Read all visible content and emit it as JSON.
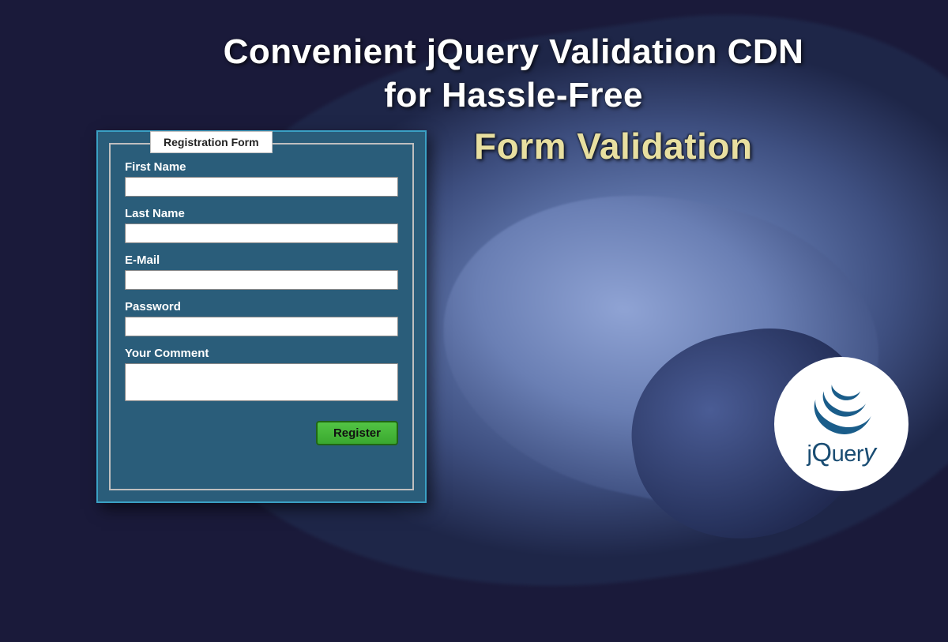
{
  "headline": {
    "line1": "Convenient jQuery Validation CDN",
    "line2": "for Hassle-Free",
    "accent": "Form Validation"
  },
  "form": {
    "legend": "Registration Form",
    "fields": {
      "first_name": {
        "label": "First Name",
        "value": ""
      },
      "last_name": {
        "label": "Last Name",
        "value": ""
      },
      "email": {
        "label": "E-Mail",
        "value": ""
      },
      "password": {
        "label": "Password",
        "value": ""
      },
      "comment": {
        "label": "Your Comment",
        "value": ""
      }
    },
    "submit_label": "Register"
  },
  "logo": {
    "name": "jQuery",
    "icon_name": "jquery-swirl-icon"
  },
  "colors": {
    "background": "#1a1a3a",
    "form_bg": "#2a5d7a",
    "form_border": "#3aa0c4",
    "accent_text": "#e8dfa0",
    "button_bg": "#3aa82f",
    "logo_color": "#1a4d73"
  }
}
